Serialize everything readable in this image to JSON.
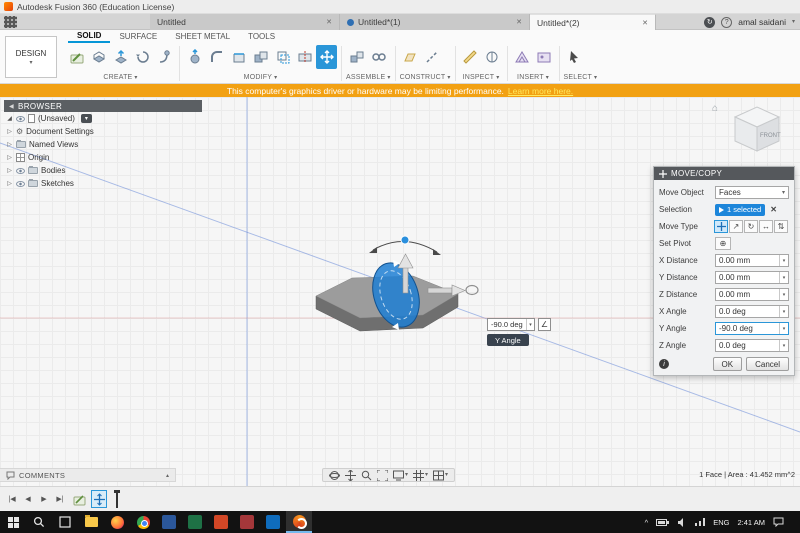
{
  "window": {
    "title": "Autodesk Fusion 360 (Education License)"
  },
  "tabbar": {
    "tabs": [
      {
        "label": "Untitled"
      },
      {
        "label": "Untitled*(1)"
      },
      {
        "label": "Untitled*(2)"
      }
    ],
    "user": "amal saidani"
  },
  "ribbon": {
    "workspace": "DESIGN",
    "tabs": [
      {
        "label": "SOLID"
      },
      {
        "label": "SURFACE"
      },
      {
        "label": "SHEET METAL"
      },
      {
        "label": "TOOLS"
      }
    ],
    "groups": [
      {
        "label": "CREATE"
      },
      {
        "label": "MODIFY"
      },
      {
        "label": "ASSEMBLE"
      },
      {
        "label": "CONSTRUCT"
      },
      {
        "label": "INSPECT"
      },
      {
        "label": "INSERT"
      },
      {
        "label": "SELECT"
      }
    ]
  },
  "banner": {
    "message": "This computer's graphics driver or hardware may be limiting performance.",
    "link": "Learn more here."
  },
  "browser": {
    "title": "BROWSER",
    "root": "(Unsaved)",
    "items": [
      {
        "label": "Document Settings"
      },
      {
        "label": "Named Views"
      },
      {
        "label": "Origin"
      },
      {
        "label": "Bodies"
      },
      {
        "label": "Sketches"
      }
    ]
  },
  "viewcube": {
    "face": "FRONT"
  },
  "dialog": {
    "title": "MOVE/COPY",
    "move_object_label": "Move Object",
    "move_object_value": "Faces",
    "selection_label": "Selection",
    "selection_value": "1 selected",
    "move_type_label": "Move Type",
    "set_pivot_label": "Set Pivot",
    "fields": [
      {
        "label": "X Distance",
        "value": "0.00 mm"
      },
      {
        "label": "Y Distance",
        "value": "0.00 mm"
      },
      {
        "label": "Z Distance",
        "value": "0.00 mm"
      },
      {
        "label": "X Angle",
        "value": "0.0 deg"
      },
      {
        "label": "Y Angle",
        "value": "-90.0 deg"
      },
      {
        "label": "Z Angle",
        "value": "0.0 deg"
      }
    ],
    "ok": "OK",
    "cancel": "Cancel"
  },
  "canvas": {
    "angle_value": "-90.0 deg",
    "angle_tooltip": "Y Angle"
  },
  "footer": {
    "comments": "COMMENTS",
    "selection_info": "1 Face | Area : 41.452 mm^2"
  },
  "taskbar": {
    "language": "ENG",
    "time": "2:41 AM"
  },
  "colors": {
    "accent": "#0696d7",
    "banner": "#f2a113",
    "manipulator": "#1f7fd4"
  },
  "ui": {
    "caret": "▾",
    "caret_up": "^",
    "close": "✕",
    "home": "⌂",
    "question": "?",
    "info": "i",
    "rotate": "↻",
    "arrow_ne": "↗",
    "arrow_lr": "↔",
    "arrow_ud": "⇅",
    "pivot": "⊕",
    "angle": "∠",
    "gear": "⚙",
    "tree_open": "◢",
    "tree_closed": "▷",
    "collapse": "◀",
    "media": [
      "|◀",
      "◀",
      "▶",
      "▶|"
    ]
  }
}
